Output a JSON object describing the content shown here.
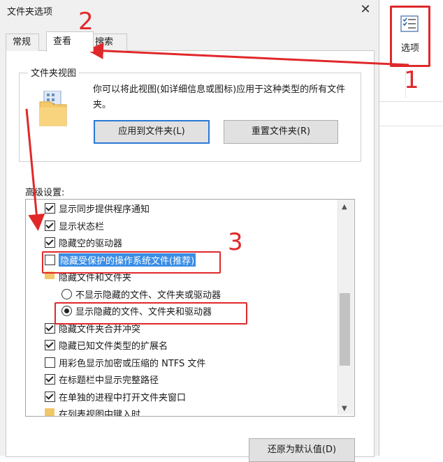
{
  "dialog": {
    "title": "文件夹选项",
    "close": "✕",
    "tabs": [
      {
        "label": "常规",
        "active": false
      },
      {
        "label": "查看",
        "active": true
      },
      {
        "label": "搜索",
        "active": false
      }
    ],
    "folder_views": {
      "title": "文件夹视图",
      "description": "你可以将此视图(如详细信息或图标)应用于这种类型的所有文件夹。",
      "apply_button": "应用到文件夹(L)",
      "reset_button": "重置文件夹(R)"
    },
    "advanced_label": "高级设置:",
    "advanced_items": [
      {
        "type": "checkbox",
        "checked": true,
        "label": "显示同步提供程序通知"
      },
      {
        "type": "checkbox",
        "checked": true,
        "label": "显示状态栏"
      },
      {
        "type": "checkbox",
        "checked": true,
        "label": "隐藏空的驱动器"
      },
      {
        "type": "checkbox",
        "checked": false,
        "label": "隐藏受保护的操作系统文件(推荐)",
        "highlighted": true
      },
      {
        "type": "folder",
        "label": "隐藏文件和文件夹"
      },
      {
        "type": "radio",
        "checked": false,
        "label": "不显示隐藏的文件、文件夹或驱动器"
      },
      {
        "type": "radio",
        "checked": true,
        "label": "显示隐藏的文件、文件夹和驱动器"
      },
      {
        "type": "checkbox",
        "checked": true,
        "label": "隐藏文件夹合并冲突"
      },
      {
        "type": "checkbox",
        "checked": true,
        "label": "隐藏已知文件类型的扩展名"
      },
      {
        "type": "checkbox",
        "checked": false,
        "label": "用彩色显示加密或压缩的 NTFS 文件"
      },
      {
        "type": "checkbox",
        "checked": true,
        "label": "在标题栏中显示完整路径"
      },
      {
        "type": "checkbox",
        "checked": true,
        "label": "在单独的进程中打开文件夹窗口"
      },
      {
        "type": "folder",
        "label": "在列表视图中键入时"
      }
    ],
    "scroll_up": "▲",
    "scroll_down": "▼",
    "restore_button": "还原为默认值(D)"
  },
  "ribbon": {
    "options_label": "选项",
    "options_icon": "options-list-icon"
  },
  "annotations": {
    "step1": "1",
    "step2": "2",
    "step3": "3",
    "color": "#e0282b"
  },
  "colors": {
    "selection": "#3a8ee6",
    "focus_border": "#2a78d6",
    "dialog_bg": "#f0f0f0"
  }
}
